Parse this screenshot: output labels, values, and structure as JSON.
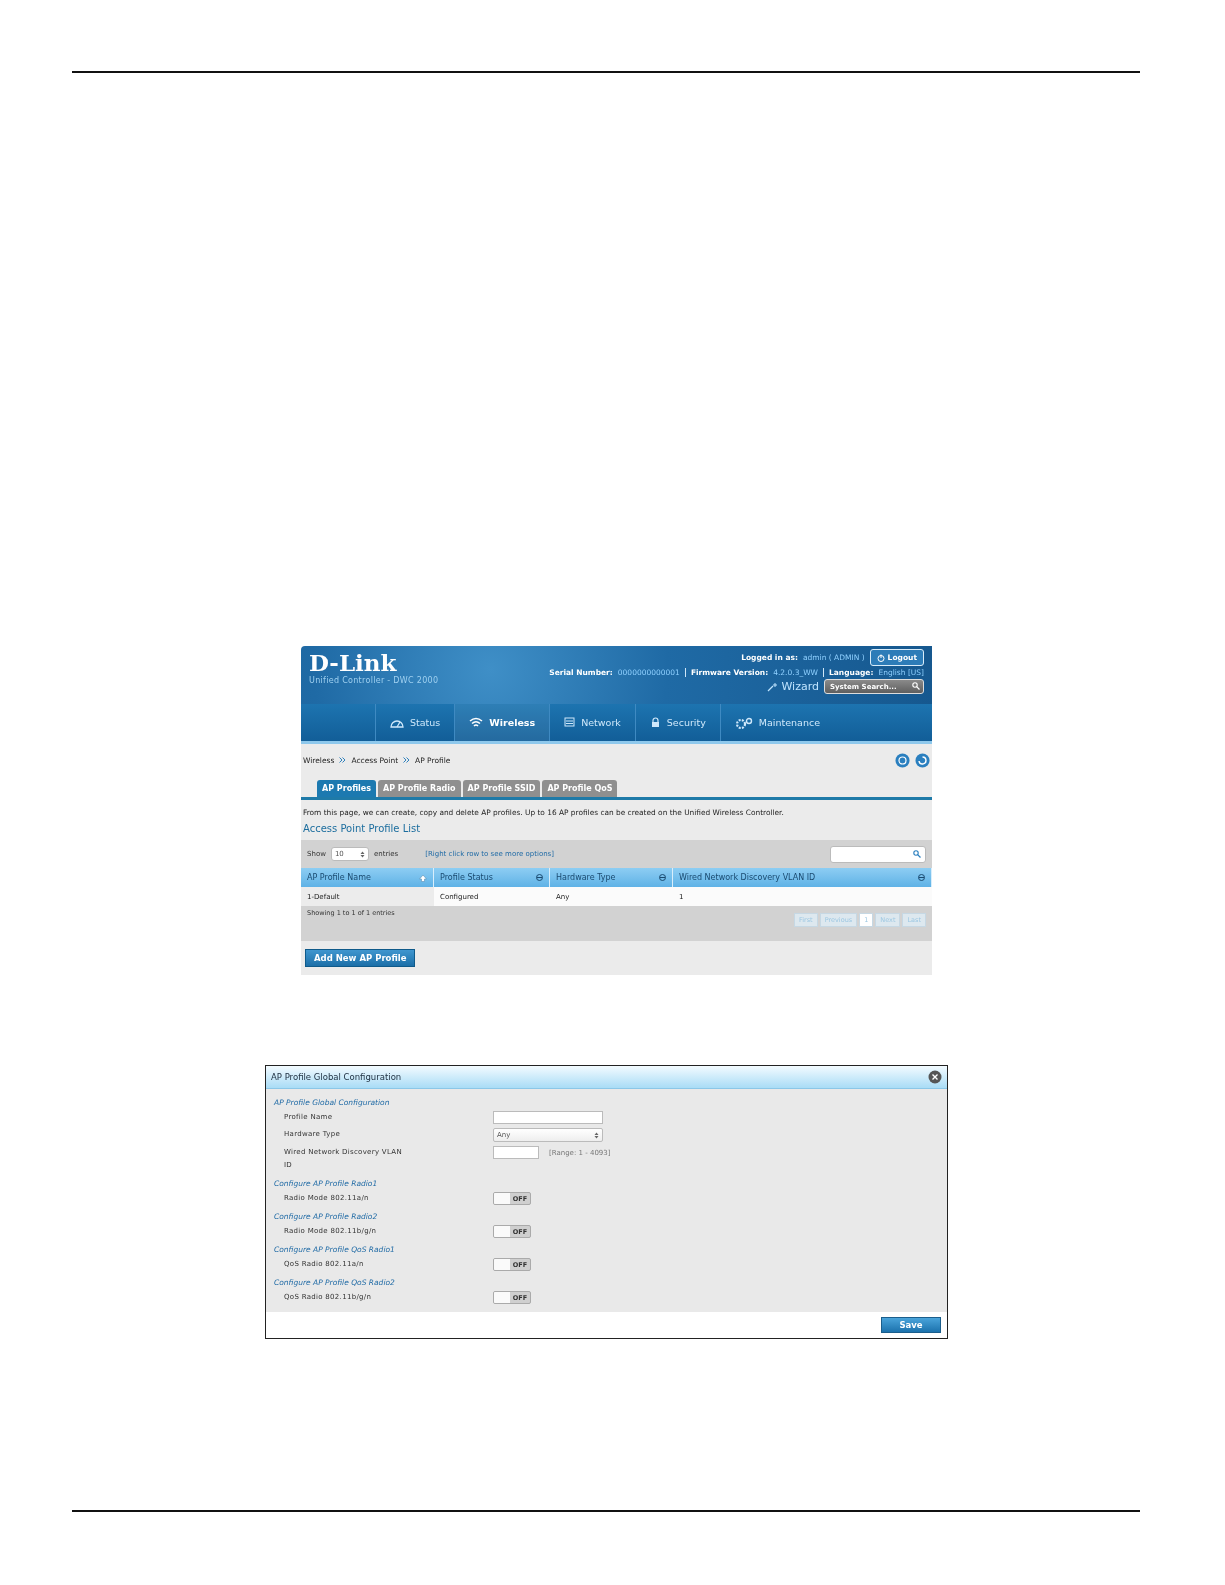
{
  "header": {
    "logo": "D-Link",
    "product": "Unified Controller - DWC 2000",
    "logged_in_label": "Logged in as:",
    "user": "admin ( ADMIN )",
    "logout": "Logout",
    "serial_label": "Serial Number:",
    "serial": "0000000000001",
    "firmware_label": "Firmware Version:",
    "firmware": "4.2.0.3_WW",
    "language_label": "Language:",
    "language": "English [US]",
    "wizard": "Wizard",
    "search": {
      "placeholder": "System Search..."
    }
  },
  "nav": [
    {
      "label": "Status",
      "selected": false
    },
    {
      "label": "Wireless",
      "selected": true
    },
    {
      "label": "Network",
      "selected": false
    },
    {
      "label": "Security",
      "selected": false
    },
    {
      "label": "Maintenance",
      "selected": false
    }
  ],
  "breadcrumb": [
    "Wireless",
    "Access Point",
    "AP Profile"
  ],
  "tabs": [
    {
      "label": "AP Profiles",
      "selected": true
    },
    {
      "label": "AP Profile Radio",
      "selected": false
    },
    {
      "label": "AP Profile SSID",
      "selected": false
    },
    {
      "label": "AP Profile QoS",
      "selected": false
    }
  ],
  "description": "From this page, we can create, copy and delete AP profiles. Up to 16 AP profiles can be created on the Unified Wireless Controller.",
  "list_title": "Access Point Profile List",
  "table": {
    "show_label": "Show",
    "page_size": "10",
    "entries_label": "entries",
    "hint": "[Right click row to see more options]",
    "columns": [
      {
        "label": "AP Profile Name",
        "sorted": true
      },
      {
        "label": "Profile Status",
        "sorted": false
      },
      {
        "label": "Hardware Type",
        "sorted": false
      },
      {
        "label": "Wired Network Discovery VLAN ID",
        "sorted": false
      }
    ],
    "rows": [
      [
        "1-Default",
        "Configured",
        "Any",
        "1"
      ]
    ],
    "info": "Showing 1 to 1 of 1 entries",
    "pager": [
      {
        "label": "First",
        "selected": false
      },
      {
        "label": "Previous",
        "selected": false
      },
      {
        "label": "1",
        "selected": true
      },
      {
        "label": "Next",
        "selected": false
      },
      {
        "label": "Last",
        "selected": false
      }
    ]
  },
  "add_button": "Add New AP Profile",
  "dialog": {
    "title": "AP Profile Global Configuration",
    "sections": [
      {
        "title": "AP Profile Global Configuration",
        "fields": [
          {
            "kind": "text",
            "label": "Profile Name"
          },
          {
            "kind": "select",
            "label": "Hardware Type",
            "value": "Any"
          },
          {
            "kind": "number",
            "label": "Wired Network Discovery VLAN ID",
            "hint": "[Range: 1 - 4093]"
          }
        ]
      },
      {
        "title": "Configure AP Profile Radio1",
        "fields": [
          {
            "kind": "toggle",
            "label": "Radio Mode 802.11a/n",
            "on": false,
            "state_text": "OFF"
          }
        ]
      },
      {
        "title": "Configure AP Profile Radio2",
        "fields": [
          {
            "kind": "toggle",
            "label": "Radio Mode 802.11b/g/n",
            "on": false,
            "state_text": "OFF"
          }
        ]
      },
      {
        "title": "Configure AP Profile QoS Radio1",
        "fields": [
          {
            "kind": "toggle",
            "label": "QoS Radio 802.11a/n",
            "on": false,
            "state_text": "OFF"
          }
        ]
      },
      {
        "title": "Configure AP Profile QoS Radio2",
        "fields": [
          {
            "kind": "toggle",
            "label": "QoS Radio 802.11b/g/n",
            "on": false,
            "state_text": "OFF"
          }
        ]
      }
    ],
    "save": "Save"
  }
}
